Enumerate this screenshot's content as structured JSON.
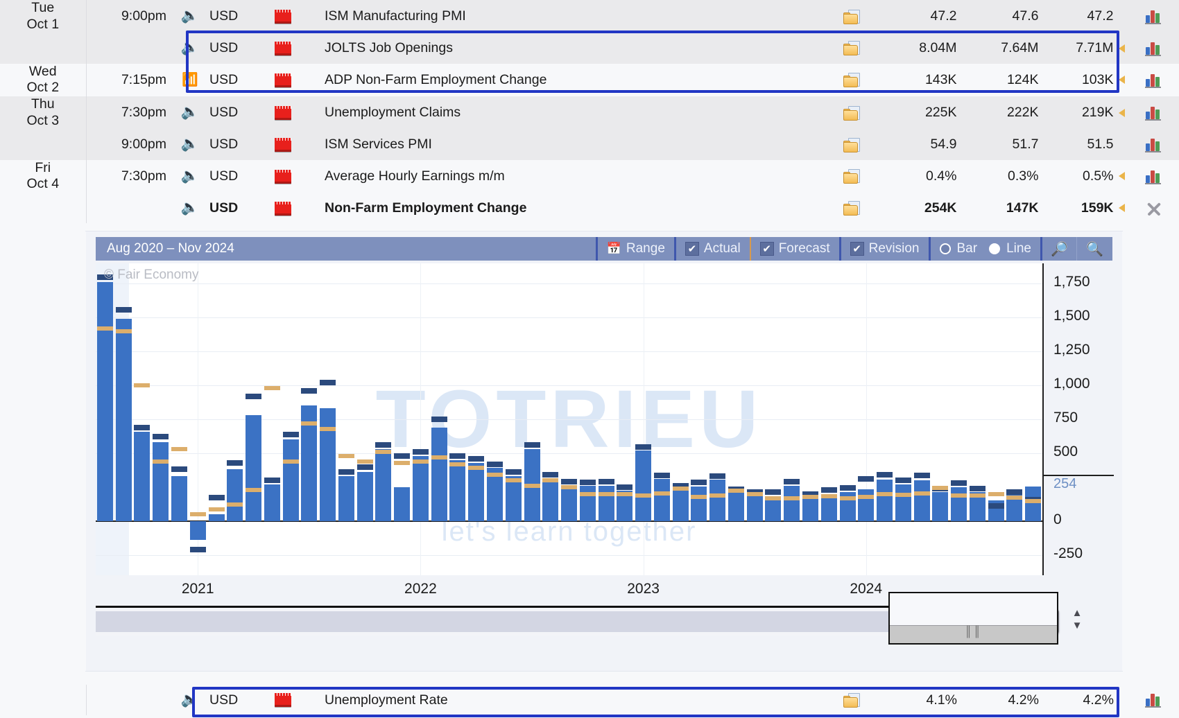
{
  "calendar": {
    "rows": [
      {
        "date_day": "Tue",
        "date_num": "Oct 1",
        "time": "9:00pm",
        "alert": "speaker-icon",
        "currency": "USD",
        "impact": "high",
        "event": "ISM Manufacturing PMI",
        "actual": "47.2",
        "actual_color": "red",
        "forecast": "47.6",
        "previous": "47.2",
        "revised": false,
        "bold": false,
        "graph": "bar-chart-icon",
        "shade": "alt"
      },
      {
        "date_day": "",
        "date_num": "",
        "time": "",
        "alert": "speaker-icon",
        "currency": "USD",
        "impact": "high",
        "event": "JOLTS Job Openings",
        "actual": "8.04M",
        "actual_color": "green",
        "forecast": "7.64M",
        "previous": "7.71M",
        "revised": true,
        "bold": false,
        "graph": "bar-chart-icon",
        "shade": "alt"
      },
      {
        "date_day": "Wed",
        "date_num": "Oct 2",
        "time": "7:15pm",
        "alert": "wifi-icon",
        "currency": "USD",
        "impact": "high",
        "event": "ADP Non-Farm Employment Change",
        "actual": "143K",
        "actual_color": "green",
        "forecast": "124K",
        "previous": "103K",
        "revised": true,
        "bold": false,
        "graph": "bar-chart-icon",
        "shade": "norm"
      },
      {
        "date_day": "Thu",
        "date_num": "Oct 3",
        "time": "7:30pm",
        "alert": "speaker-icon",
        "currency": "USD",
        "impact": "high",
        "event": "Unemployment Claims",
        "actual": "225K",
        "actual_color": "plain",
        "forecast": "222K",
        "previous": "219K",
        "revised": true,
        "bold": false,
        "graph": "bar-chart-icon",
        "shade": "alt"
      },
      {
        "date_day": "",
        "date_num": "",
        "time": "9:00pm",
        "alert": "speaker-icon",
        "currency": "USD",
        "impact": "high",
        "event": "ISM Services PMI",
        "actual": "54.9",
        "actual_color": "green",
        "forecast": "51.7",
        "previous": "51.5",
        "revised": false,
        "bold": false,
        "graph": "bar-chart-icon",
        "shade": "alt"
      },
      {
        "date_day": "Fri",
        "date_num": "Oct 4",
        "time": "7:30pm",
        "alert": "speaker-icon",
        "currency": "USD",
        "impact": "high",
        "event": "Average Hourly Earnings m/m",
        "actual": "0.4%",
        "actual_color": "green",
        "forecast": "0.3%",
        "previous": "0.5%",
        "previous_color": "green",
        "revised": true,
        "bold": false,
        "graph": "bar-chart-icon",
        "shade": "norm"
      },
      {
        "date_day": "",
        "date_num": "",
        "time": "",
        "alert": "speaker-icon",
        "currency": "USD",
        "impact": "high",
        "event": "Non-Farm Employment Change",
        "actual": "254K",
        "actual_color": "green",
        "forecast": "147K",
        "previous": "159K",
        "previous_color": "green",
        "revised": true,
        "bold": true,
        "graph": "close-icon",
        "shade": "norm"
      }
    ],
    "bottom_row": {
      "alert": "speaker-icon",
      "currency": "USD",
      "impact": "high",
      "event": "Unemployment Rate",
      "actual": "4.1%",
      "actual_color": "green",
      "forecast": "4.2%",
      "previous": "4.2%",
      "revised": false,
      "graph": "bar-chart-icon"
    }
  },
  "chart_panel": {
    "toolbar": {
      "title": "Aug 2020 – Nov 2024",
      "range_label": "Range",
      "range_icon": "calendar-icon",
      "actual_label": "Actual",
      "actual_checked": true,
      "forecast_label": "Forecast",
      "forecast_checked": true,
      "revision_label": "Revision",
      "revision_checked": true,
      "bar_label": "Bar",
      "line_label": "Line",
      "mode_selected": "Line",
      "zoom_in_icon": "zoom-in-icon",
      "zoom_out_icon": "zoom-out-icon"
    },
    "copyright": "© Fair Economy",
    "watermark_main": "TOTRIEU",
    "watermark_sub": "let's learn together",
    "current_value_marker": "254"
  },
  "chart_data": {
    "type": "bar",
    "title": "Non-Farm Employment Change",
    "subtitle": "Aug 2020 – Nov 2024",
    "xlabel": "",
    "ylabel": "",
    "ylim": [
      -400,
      1900
    ],
    "yticks": [
      "-250",
      "0",
      "500",
      "750",
      "1,000",
      "1,250",
      "1,500",
      "1,750"
    ],
    "ytick_values": [
      -250,
      0,
      500,
      750,
      1000,
      1250,
      1500,
      1750
    ],
    "highlight_tick": "254",
    "grid": true,
    "legend_position": "toolbar",
    "xticks": [
      "2021",
      "2022",
      "2023",
      "2024"
    ],
    "xtick_values": [
      2021,
      2022,
      2023,
      2024
    ],
    "series": [
      {
        "name": "Actual",
        "color": "#3b72c4"
      },
      {
        "name": "Forecast",
        "color": "#dcae6b"
      },
      {
        "name": "Revision",
        "color": "#2b4a7d"
      }
    ],
    "points": [
      {
        "x": "Aug 2020",
        "actual": 1760,
        "forecast": 1420,
        "revision": 1800
      },
      {
        "x": "Sep 2020",
        "actual": 1490,
        "forecast": 1400,
        "revision": 1560
      },
      {
        "x": "Oct 2020",
        "actual": 660,
        "forecast": 1000,
        "revision": 690
      },
      {
        "x": "Nov 2020",
        "actual": 580,
        "forecast": 440,
        "revision": 625
      },
      {
        "x": "Dec 2020",
        "actual": 330,
        "forecast": 530,
        "revision": 380
      },
      {
        "x": "Jan 2021",
        "actual": -140,
        "forecast": 50,
        "revision": -210
      },
      {
        "x": "Feb 2021",
        "actual": 50,
        "forecast": 85,
        "revision": 175
      },
      {
        "x": "Mar 2021",
        "actual": 380,
        "forecast": 120,
        "revision": 430
      },
      {
        "x": "Apr 2021",
        "actual": 780,
        "forecast": 230,
        "revision": 920
      },
      {
        "x": "May 2021",
        "actual": 270,
        "forecast": 980,
        "revision": 300
      },
      {
        "x": "Jun 2021",
        "actual": 600,
        "forecast": 440,
        "revision": 640
      },
      {
        "x": "Jul 2021",
        "actual": 850,
        "forecast": 720,
        "revision": 960
      },
      {
        "x": "Aug 2021",
        "actual": 830,
        "forecast": 680,
        "revision": 1020
      },
      {
        "x": "Sep 2021",
        "actual": 330,
        "forecast": 480,
        "revision": 360
      },
      {
        "x": "Oct 2021",
        "actual": 360,
        "forecast": 440,
        "revision": 400
      },
      {
        "x": "Nov 2021",
        "actual": 530,
        "forecast": 510,
        "revision": 560
      },
      {
        "x": "Dec 2021",
        "actual": 250,
        "forecast": 430,
        "revision": 480
      },
      {
        "x": "Jan 2022",
        "actual": 480,
        "forecast": 440,
        "revision": 510
      },
      {
        "x": "Feb 2022",
        "actual": 690,
        "forecast": 470,
        "revision": 750
      },
      {
        "x": "Mar 2022",
        "actual": 450,
        "forecast": 420,
        "revision": 480
      },
      {
        "x": "Apr 2022",
        "actual": 430,
        "forecast": 390,
        "revision": 460
      },
      {
        "x": "May 2022",
        "actual": 390,
        "forecast": 340,
        "revision": 420
      },
      {
        "x": "Jun 2022",
        "actual": 330,
        "forecast": 300,
        "revision": 360
      },
      {
        "x": "Jul 2022",
        "actual": 530,
        "forecast": 260,
        "revision": 560
      },
      {
        "x": "Aug 2022",
        "actual": 315,
        "forecast": 300,
        "revision": 340
      },
      {
        "x": "Sep 2022",
        "actual": 265,
        "forecast": 250,
        "revision": 290
      },
      {
        "x": "Oct 2022",
        "actual": 260,
        "forecast": 200,
        "revision": 285
      },
      {
        "x": "Nov 2022",
        "actual": 260,
        "forecast": 200,
        "revision": 290
      },
      {
        "x": "Dec 2022",
        "actual": 225,
        "forecast": 200,
        "revision": 250
      },
      {
        "x": "Jan 2023",
        "actual": 520,
        "forecast": 190,
        "revision": 545
      },
      {
        "x": "Feb 2023",
        "actual": 310,
        "forecast": 205,
        "revision": 335
      },
      {
        "x": "Mar 2023",
        "actual": 235,
        "forecast": 240,
        "revision": 260
      },
      {
        "x": "Apr 2023",
        "actual": 255,
        "forecast": 180,
        "revision": 285
      },
      {
        "x": "May 2023",
        "actual": 305,
        "forecast": 190,
        "revision": 330
      },
      {
        "x": "Jun 2023",
        "actual": 210,
        "forecast": 225,
        "revision": 235
      },
      {
        "x": "Jul 2023",
        "actual": 185,
        "forecast": 200,
        "revision": 215
      },
      {
        "x": "Aug 2023",
        "actual": 185,
        "forecast": 170,
        "revision": 215
      },
      {
        "x": "Sep 2023",
        "actual": 260,
        "forecast": 170,
        "revision": 290
      },
      {
        "x": "Oct 2023",
        "actual": 160,
        "forecast": 180,
        "revision": 200
      },
      {
        "x": "Nov 2023",
        "actual": 200,
        "forecast": 185,
        "revision": 230
      },
      {
        "x": "Dec 2023",
        "actual": 215,
        "forecast": 170,
        "revision": 245
      },
      {
        "x": "Jan 2024",
        "actual": 235,
        "forecast": 180,
        "revision": 310
      },
      {
        "x": "Feb 2024",
        "actual": 305,
        "forecast": 200,
        "revision": 340
      },
      {
        "x": "Mar 2024",
        "actual": 270,
        "forecast": 195,
        "revision": 300
      },
      {
        "x": "Apr 2024",
        "actual": 300,
        "forecast": 205,
        "revision": 335
      },
      {
        "x": "May 2024",
        "actual": 215,
        "forecast": 245,
        "revision": 240
      },
      {
        "x": "Jun 2024",
        "actual": 250,
        "forecast": 190,
        "revision": 280
      },
      {
        "x": "Jul 2024",
        "actual": 215,
        "forecast": 190,
        "revision": 240
      },
      {
        "x": "Aug 2024",
        "actual": 150,
        "forecast": 200,
        "revision": 110
      },
      {
        "x": "Sep 2024",
        "actual": 195,
        "forecast": 175,
        "revision": 215
      },
      {
        "x": "Oct 2024",
        "actual": 254,
        "forecast": 147,
        "revision": 159
      }
    ]
  }
}
